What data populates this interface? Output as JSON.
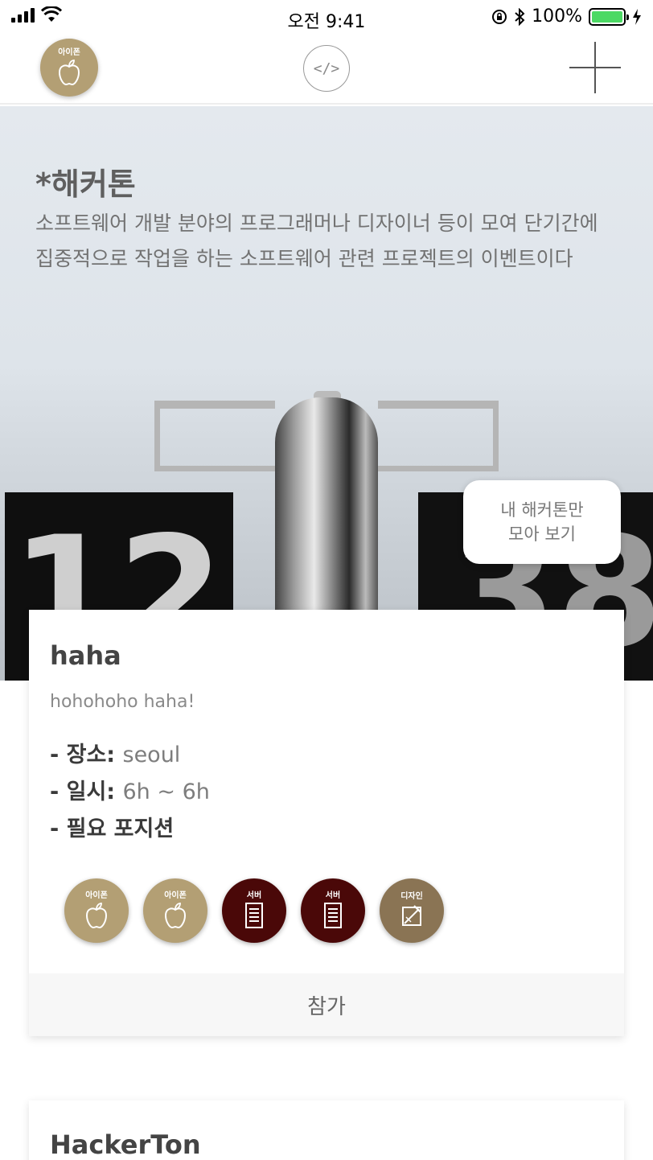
{
  "status_bar": {
    "time": "오전 9:41",
    "battery": "100%"
  },
  "nav": {
    "avatar_label": "아이폰",
    "code_icon": "</>"
  },
  "hero": {
    "title": "*해커톤",
    "description": "소프트웨어 개발 분야의 프로그래머나 디자이너 등이 모여 단기간에 집중적으로 작업을 하는 소프트웨어 관련 프로젝트의 이벤트이다",
    "my_hackathons_button": "내 해커톤만\n모아 보기"
  },
  "cards": [
    {
      "title": "haha",
      "subtitle": "hohohoho haha!",
      "place_label": "- 장소:",
      "place_value": "seoul",
      "time_label": "- 일시:",
      "time_value": "6h ~ 6h",
      "positions_label": "- 필요 포지션",
      "positions": [
        {
          "label": "아이폰",
          "icon": "apple-icon",
          "color": "#b39f74"
        },
        {
          "label": "아이폰",
          "icon": "apple-icon",
          "color": "#b39f74"
        },
        {
          "label": "서버",
          "icon": "server-icon",
          "color": "#4a0808"
        },
        {
          "label": "서버",
          "icon": "server-icon",
          "color": "#4a0808"
        },
        {
          "label": "디자인",
          "icon": "design-icon",
          "color": "#8a7454"
        }
      ],
      "join_button": "참가"
    },
    {
      "title": "HackerTon"
    }
  ],
  "colors": {
    "apple_badge": "#b39f74",
    "server_badge": "#4a0808",
    "design_badge": "#8a7454",
    "battery": "#4cd964"
  }
}
